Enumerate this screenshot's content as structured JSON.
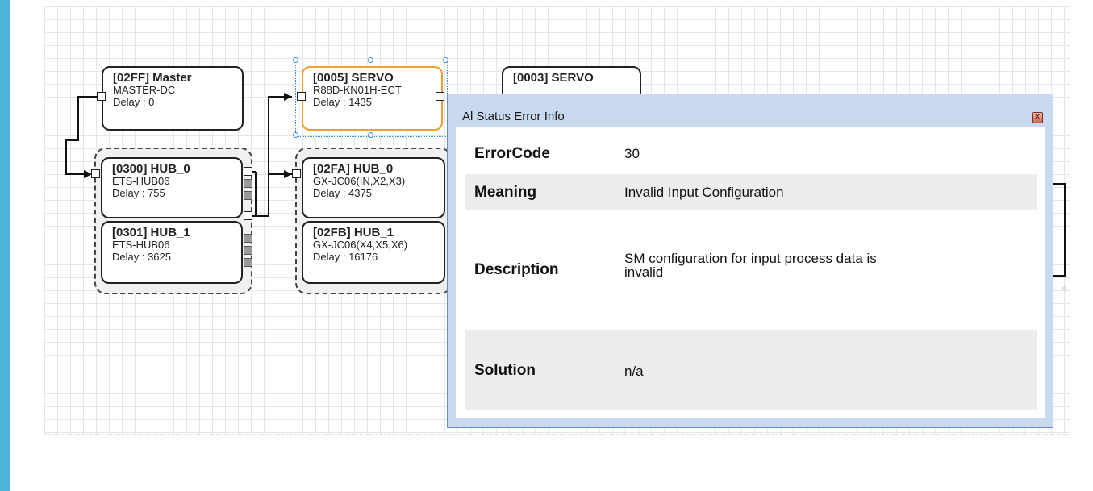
{
  "topology": {
    "nodes": [
      {
        "key": "master",
        "title": "[02FF] Master",
        "model": "MASTER-DC",
        "delay": "Delay : 0"
      },
      {
        "key": "servo-0005",
        "title": "[0005] SERVO",
        "model": "R88D-KN01H-ECT",
        "delay": "Delay : 1435"
      },
      {
        "key": "servo-0003",
        "title": "[0003] SERVO",
        "model": "",
        "delay": ""
      },
      {
        "key": "hub-0300",
        "title": "[0300] HUB_0",
        "model": "ETS-HUB06",
        "delay": "Delay : 755"
      },
      {
        "key": "hub-0301",
        "title": "[0301] HUB_1",
        "model": "ETS-HUB06",
        "delay": "Delay : 3625"
      },
      {
        "key": "hub-02fa",
        "title": "[02FA] HUB_0",
        "model": "GX-JC06(IN,X2,X3)",
        "delay": "Delay : 4375"
      },
      {
        "key": "hub-02fb",
        "title": "[02FB] HUB_1",
        "model": "GX-JC06(X4,X5,X6)",
        "delay": "Delay : 16176"
      }
    ]
  },
  "dialog": {
    "title": "Al Status Error Info",
    "close_icon": "close-icon",
    "rows": [
      {
        "label": "ErrorCode",
        "value": "30"
      },
      {
        "label": "Meaning",
        "value": "Invalid Input Configuration"
      },
      {
        "label": "Description",
        "value": "SM configuration for input process data is",
        "value2": "invalid"
      },
      {
        "label": "Solution",
        "value": "n/a"
      }
    ]
  },
  "colors": {
    "accent_strip": "#4fb3d9",
    "selected_border": "#f0a030",
    "dialog_frame": "#c9daf0",
    "row_shade": "#ededed"
  }
}
